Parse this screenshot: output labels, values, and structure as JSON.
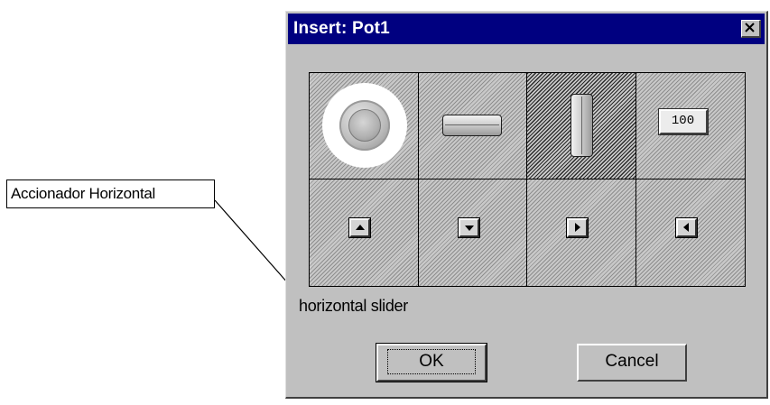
{
  "callout": {
    "label": "Accionador Horizontal"
  },
  "dialog": {
    "title": "Insert: Pot1",
    "close_label": "×",
    "items": [
      {
        "name": "knob",
        "icon": "rotary-knob-icon"
      },
      {
        "name": "horizontal-slider",
        "icon": "horizontal-slider-icon",
        "hover": true
      },
      {
        "name": "vertical-slider",
        "icon": "vertical-slider-icon",
        "selected": true
      },
      {
        "name": "number-display",
        "icon": "number-display-icon",
        "value": "100"
      },
      {
        "name": "up-button",
        "icon": "up-arrow-icon"
      },
      {
        "name": "down-button",
        "icon": "down-arrow-icon"
      },
      {
        "name": "right-button",
        "icon": "right-arrow-icon"
      },
      {
        "name": "left-button",
        "icon": "left-arrow-icon"
      }
    ],
    "status_text": "horizontal slider",
    "ok_label": "OK",
    "cancel_label": "Cancel"
  }
}
